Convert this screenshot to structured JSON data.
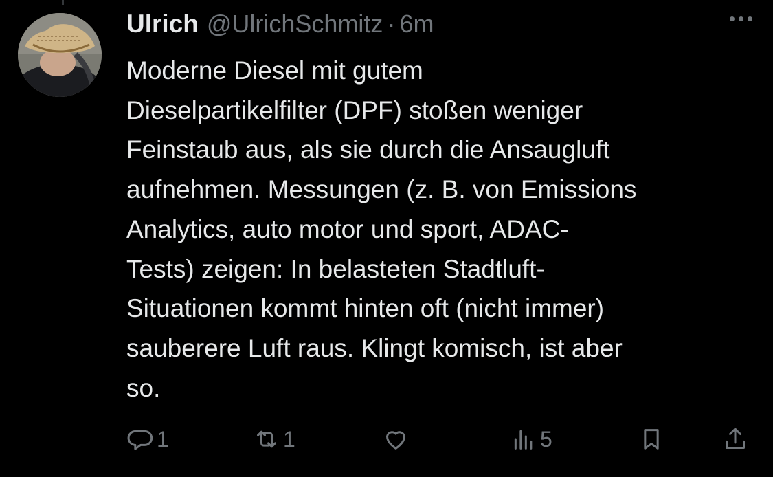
{
  "tweet": {
    "author_name": "Ulrich",
    "handle": "@UlrichSchmitz",
    "separator": "·",
    "time": "6m",
    "text_lines": [
      "Moderne Diesel mit gutem",
      "Dieselpartikelfilter (DPF) stoßen weniger",
      "Feinstaub aus, als sie durch die Ansaugluft",
      "aufnehmen. Messungen (z. B. von Emissions",
      "Analytics, auto motor und sport, ADAC-",
      "Tests) zeigen: In belasteten Stadtluft-",
      "Situationen kommt hinten oft (nicht immer)",
      "sauberere Luft raus. Klingt komisch, ist aber",
      "so."
    ]
  },
  "actions": {
    "reply_count": "1",
    "retweet_count": "1",
    "like_count": "",
    "views_count": "5"
  },
  "icons": {
    "more": "more-horizontal-icon",
    "reply": "reply-icon",
    "retweet": "retweet-icon",
    "like": "heart-icon",
    "views": "views-icon",
    "bookmark": "bookmark-icon",
    "share": "share-icon"
  },
  "colors": {
    "background": "#000000",
    "text_primary": "#e7e9ea",
    "text_secondary": "#71767b"
  }
}
